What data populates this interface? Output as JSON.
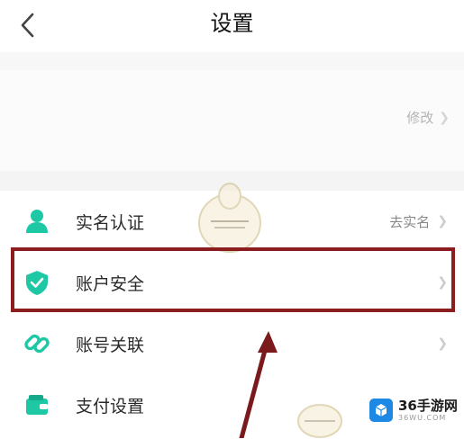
{
  "header": {
    "title": "设置",
    "back_icon": "chevron-left-icon"
  },
  "profile": {
    "edit_label": "修改"
  },
  "menu": {
    "items": [
      {
        "label": "实名认证",
        "icon": "person-icon",
        "icon_color": "#1ec8a5",
        "value": "去实名"
      },
      {
        "label": "账户安全",
        "icon": "shield-check-icon",
        "icon_color": "#1ec8a5",
        "value": ""
      },
      {
        "label": "账号关联",
        "icon": "link-icon",
        "icon_color": "#1ec8a5",
        "value": ""
      },
      {
        "label": "支付设置",
        "icon": "wallet-icon",
        "icon_color": "#1ec8a5",
        "value": ""
      }
    ]
  },
  "annotation": {
    "highlight_color": "#8b1d1f",
    "arrow_color": "#7a1a1c"
  },
  "watermark": {
    "title": "36手游网",
    "subtitle": "36WU.COM"
  }
}
